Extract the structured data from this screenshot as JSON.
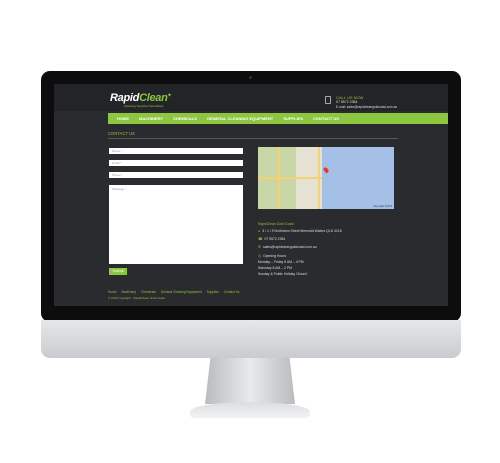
{
  "header": {
    "logo_main": "Rapid",
    "logo_accent": "Clean",
    "logo_tagline": "Cleaning Supplies Specialists",
    "call_label": "CALL US NOW",
    "phone": "07 5572 2384",
    "email": "E-mail: sales@rapidcleangoldcoast.com.au"
  },
  "nav": {
    "items": [
      "HOME",
      "MACHINERY",
      "CHEMICALS",
      "GENERAL CLEANING EQUIPMENT",
      "SUPPLIES",
      "CONTACT US"
    ]
  },
  "page": {
    "title": "CONTACT US"
  },
  "form": {
    "name_placeholder": "Name *",
    "email_placeholder": "Email *",
    "phone_placeholder": "Phone *",
    "message_placeholder": "Message *",
    "submit_label": "Submit"
  },
  "map": {
    "credit": "Map data ©2013"
  },
  "contact": {
    "business_name": "RapidClean Gold Coast",
    "address": "3 / 1 / 9 Northview Street Mermaid Waters QLD 4218",
    "phone": "07 5572 2384",
    "email": "sales@rapidcleangoldcoast.com.au",
    "hours_heading": "Opening Hours",
    "hours_weekday": "Monday – Friday 8 AM – 4 PM",
    "hours_saturday": "Saturday 8 AM – 2 PM",
    "hours_sunday": "Sunday & Public Holiday Closed"
  },
  "footer": {
    "links": [
      "Home",
      "Machinery",
      "Chemicals",
      "General Cleaning Equipment",
      "Supplies",
      "Contact Us"
    ],
    "copyright": "© 2013 copyright · RapidClean Gold Coast"
  },
  "colors": {
    "accent": "#8dc63f",
    "background": "#2a2b2e"
  },
  "icons": {
    "phone": "phone-icon",
    "apple": "apple-logo-icon",
    "location": "location-icon",
    "email": "mail-icon",
    "clock": "clock-icon"
  }
}
